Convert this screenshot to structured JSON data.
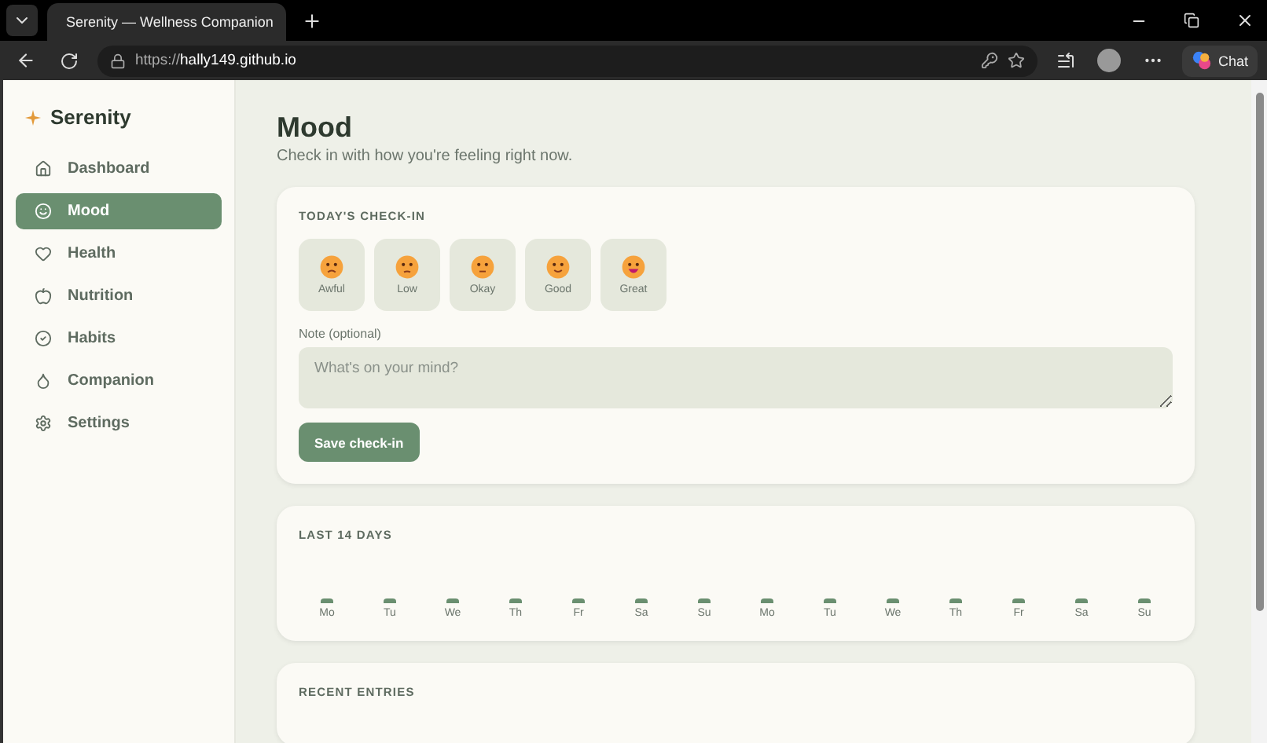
{
  "browser": {
    "tab_title": "Serenity — Wellness Companion",
    "url_scheme": "https://",
    "url_host": "hally149.github.io",
    "chat_label": "Chat"
  },
  "sidebar": {
    "brand": "Serenity",
    "items": [
      {
        "label": "Dashboard",
        "selected": false
      },
      {
        "label": "Mood",
        "selected": true
      },
      {
        "label": "Health",
        "selected": false
      },
      {
        "label": "Nutrition",
        "selected": false
      },
      {
        "label": "Habits",
        "selected": false
      },
      {
        "label": "Companion",
        "selected": false
      },
      {
        "label": "Settings",
        "selected": false
      }
    ]
  },
  "page": {
    "title": "Mood",
    "subtitle": "Check in with how you're feeling right now."
  },
  "checkin": {
    "heading": "TODAY'S CHECK-IN",
    "moods": [
      {
        "label": "Awful",
        "kind": "awful",
        "selected": false
      },
      {
        "label": "Low",
        "kind": "low",
        "selected": false
      },
      {
        "label": "Okay",
        "kind": "okay",
        "selected": false
      },
      {
        "label": "Good",
        "kind": "good",
        "selected": false
      },
      {
        "label": "Great",
        "kind": "great",
        "selected": false
      }
    ],
    "note_label": "Note (optional)",
    "note_placeholder": "What's on your mind?",
    "save_button": "Save check-in"
  },
  "history": {
    "heading": "LAST 14 DAYS",
    "days": [
      "Mo",
      "Tu",
      "We",
      "Th",
      "Fr",
      "Sa",
      "Su",
      "Mo",
      "Tu",
      "We",
      "Th",
      "Fr",
      "Sa",
      "Su"
    ]
  },
  "recent": {
    "heading": "RECENT ENTRIES"
  }
}
